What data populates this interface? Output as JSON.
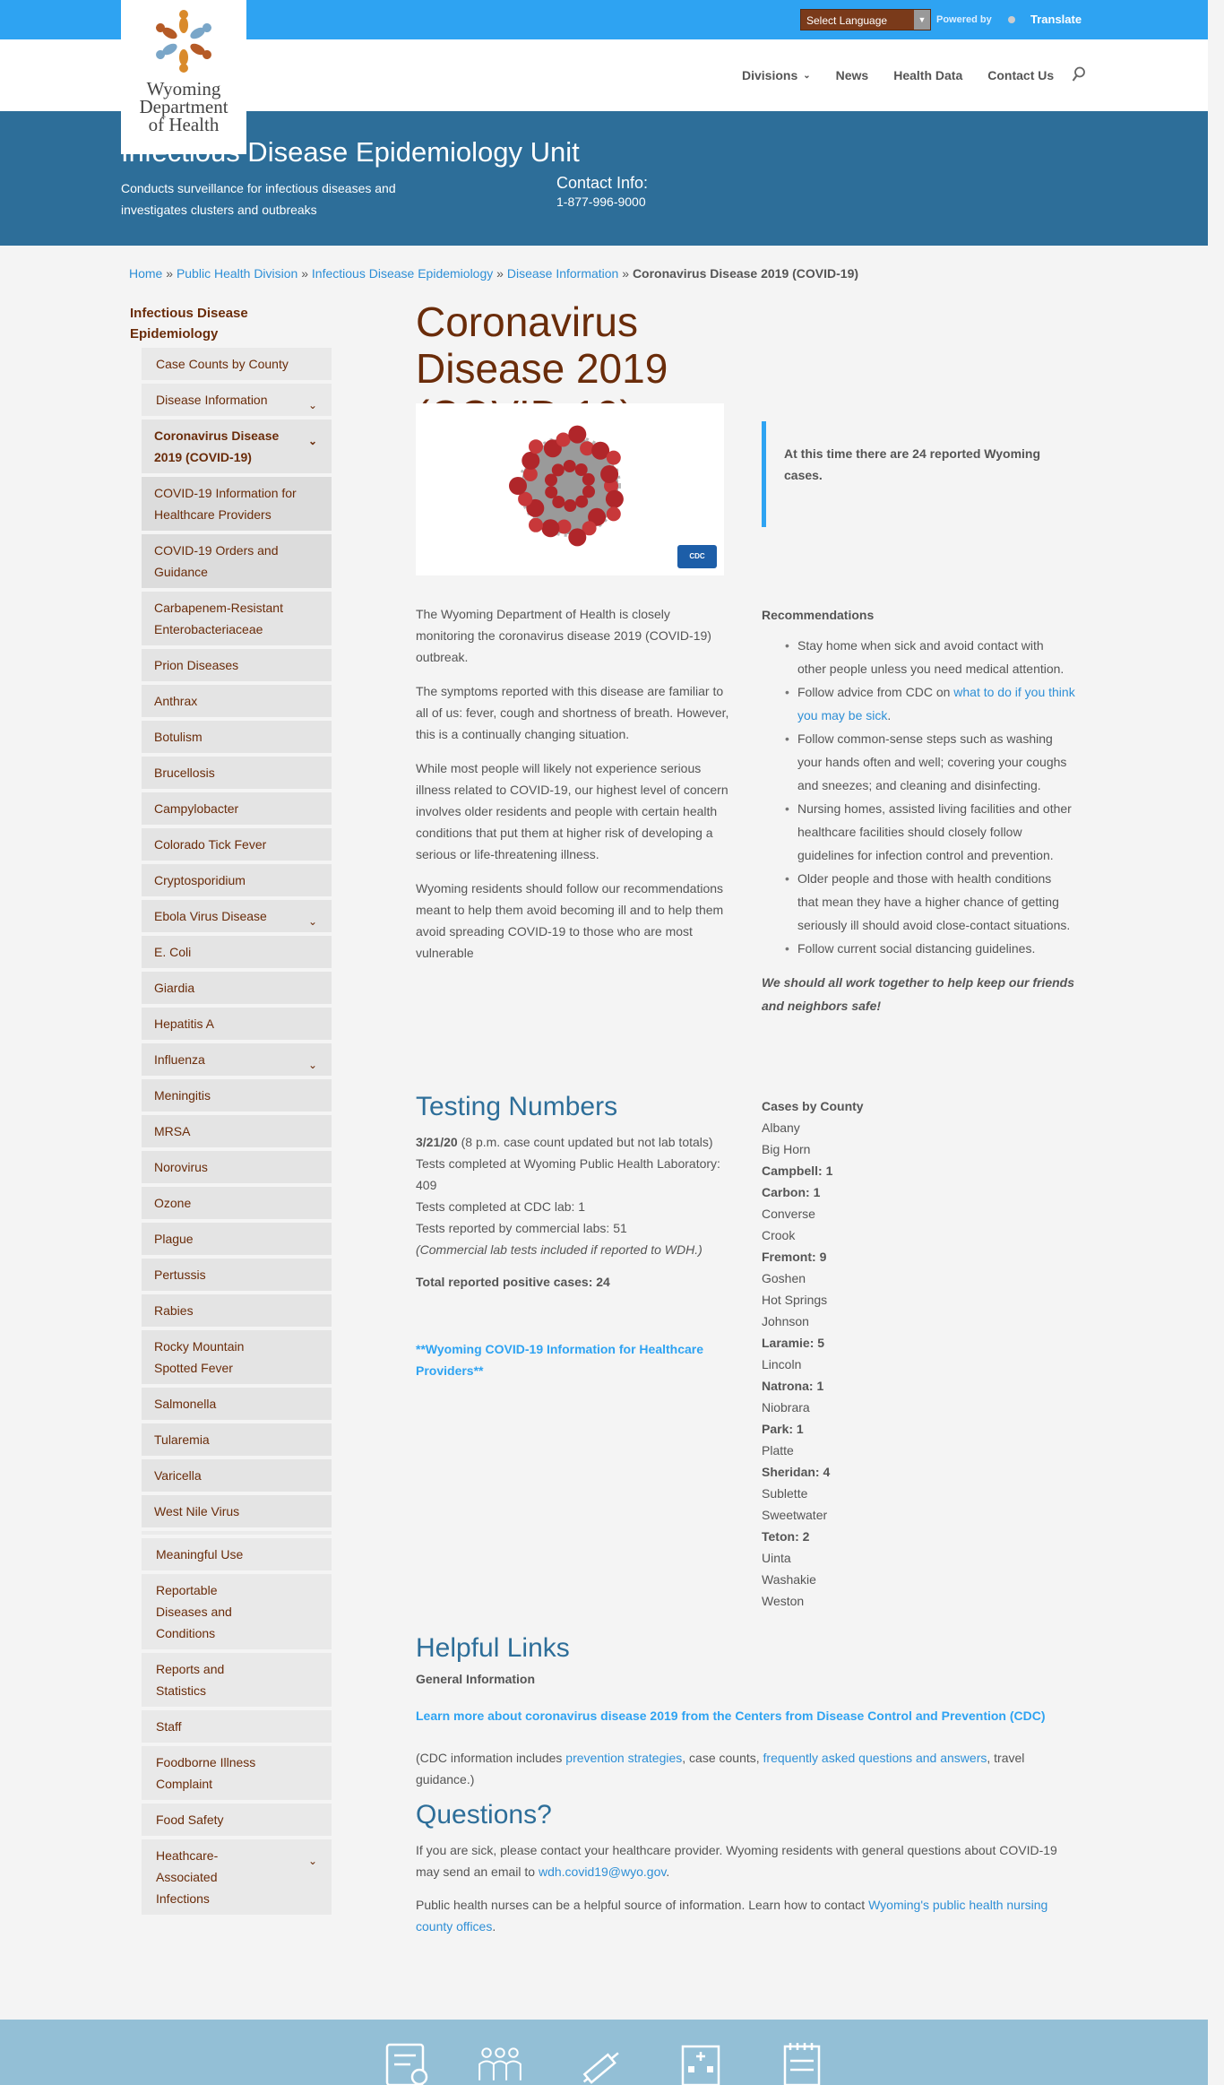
{
  "topbar": {
    "language_select": "Select Language",
    "powered_by": "Powered by",
    "translate": "Translate"
  },
  "logo": {
    "line1": "Wyoming",
    "line2": "Department",
    "line3": "of Health"
  },
  "nav": {
    "items": [
      "Divisions",
      "News",
      "Health Data",
      "Contact Us"
    ]
  },
  "banner": {
    "title": "Infectious Disease Epidemiology Unit",
    "description": "Conducts surveillance for infectious diseases and investigates clusters and outbreaks",
    "contact_label": "Contact Info:",
    "contact_phone": "1-877-996-9000"
  },
  "breadcrumb": {
    "items": [
      "Home",
      "Public Health Division",
      "Infectious Disease Epidemiology",
      "Disease Information"
    ],
    "separator": "»",
    "current": "Coronavirus Disease 2019 (COVID-19)"
  },
  "sidebar": {
    "heading": "Infectious Disease Epidemiology",
    "case_counts": "Case Counts by County",
    "disease_information": "Disease Information",
    "covid": "Coronavirus Disease 2019 (COVID-19)",
    "covid_sub": [
      "COVID-19 Information for Healthcare Providers",
      "COVID-19 Orders and Guidance"
    ],
    "diseases": [
      "Carbapenem-Resistant Enterobacteriaceae",
      "Prion Diseases",
      "Anthrax",
      "Botulism",
      "Brucellosis",
      "Campylobacter",
      "Colorado Tick Fever",
      "Cryptosporidium",
      "Ebola Virus Disease",
      "E. Coli",
      "Giardia",
      "Hepatitis A",
      "Influenza",
      "Meningitis",
      "MRSA",
      "Norovirus",
      "Ozone",
      "Plague",
      "Pertussis",
      "Rabies",
      "Rocky Mountain Spotted Fever",
      "Salmonella",
      "Tularemia",
      "Varicella",
      "West Nile Virus"
    ],
    "bottom": [
      "Meaningful Use",
      "Reportable Diseases and Conditions",
      "Reports and Statistics",
      "Staff",
      "Foodborne Illness Complaint",
      "Food Safety",
      "Heathcare-Associated Infections"
    ]
  },
  "main": {
    "title": "Coronavirus Disease 2019 (COVID-19)",
    "image_badge": "CDC",
    "callout": "At this time there are 24 reported Wyoming cases.",
    "intro": [
      "The Wyoming Department of Health is closely monitoring the coronavirus disease 2019 (COVID-19) outbreak.",
      "The symptoms reported with this disease are familiar to all of us: fever, cough and shortness of breath. However, this is a continually changing situation.",
      "While most people will likely not experience serious illness related to COVID-19, our highest level of concern involves older residents and people with certain health conditions that put them at higher risk of developing a serious or life-threatening illness.",
      "Wyoming residents should follow our recommendations meant to help them avoid becoming ill and to help them avoid spreading COVID-19 to those who are most vulnerable"
    ],
    "recommendations": {
      "title": "Recommendations",
      "item1": "Stay home when sick and avoid contact with other people unless you need medical attention.",
      "item2_prefix": "Follow advice from CDC on ",
      "item2_link": "what to do if you think you may be sick",
      "item2_suffix": ".",
      "item3": "Follow common-sense steps such as washing your hands often and well; covering your coughs and sneezes; and cleaning and disinfecting.",
      "item4": "Nursing homes, assisted living facilities and other healthcare facilities should closely follow guidelines for infection control and prevention.",
      "item5": "Older people and those with health conditions that mean they have a higher chance of getting seriously ill should avoid close-contact situations.",
      "item6": "Follow current social distancing guidelines.",
      "closing": "We should all work together to help keep our friends and neighbors safe!"
    },
    "testing": {
      "title": "Testing Numbers",
      "date": "3/21/20",
      "date_note": " (8 p.m. case count updated but not lab totals)",
      "public_lab": "Tests completed at Wyoming Public Health Laboratory: 409",
      "cdc_lab": "Tests completed at CDC lab: 1",
      "commercial": "Tests reported by commercial labs: 51",
      "commercial_note": "(Commercial lab tests included if reported to WDH.)",
      "total": "Total reported positive cases: 24",
      "healthcare_link": "**Wyoming COVID-19 Information for Healthcare Providers**"
    },
    "cases_by_county": {
      "title": "Cases by County",
      "counties": [
        {
          "name": "Albany",
          "count": ""
        },
        {
          "name": "Big Horn",
          "count": ""
        },
        {
          "name": "Campbell",
          "count": "1"
        },
        {
          "name": "Carbon",
          "count": "1"
        },
        {
          "name": "Converse",
          "count": ""
        },
        {
          "name": "Crook",
          "count": ""
        },
        {
          "name": "Fremont",
          "count": "9"
        },
        {
          "name": "Goshen",
          "count": ""
        },
        {
          "name": "Hot Springs",
          "count": ""
        },
        {
          "name": "Johnson",
          "count": ""
        },
        {
          "name": "Laramie",
          "count": "5"
        },
        {
          "name": "Lincoln",
          "count": ""
        },
        {
          "name": "Natrona",
          "count": "1"
        },
        {
          "name": "Niobrara",
          "count": ""
        },
        {
          "name": "Park",
          "count": "1"
        },
        {
          "name": "Platte",
          "count": ""
        },
        {
          "name": "Sheridan",
          "count": "4"
        },
        {
          "name": "Sublette",
          "count": ""
        },
        {
          "name": "Sweetwater",
          "count": ""
        },
        {
          "name": "Teton",
          "count": "2"
        },
        {
          "name": "Uinta",
          "count": ""
        },
        {
          "name": "Washakie",
          "count": ""
        },
        {
          "name": "Weston",
          "count": ""
        }
      ]
    },
    "helpful_links": {
      "title": "Helpful Links",
      "general": "General Information",
      "cdc_link": "Learn more about coronavirus disease 2019 from the Centers from Disease Control and Prevention (CDC)",
      "info_prefix": "(CDC information includes ",
      "prevention": "prevention strategies",
      "info_mid": ", case counts, ",
      "faq": "frequently asked questions and answers",
      "info_suffix": ", travel guidance.)"
    },
    "questions": {
      "title": "Questions?",
      "p1_prefix": "If you are sick, please contact your healthcare provider. Wyoming residents with general questions about COVID-19 may send an email to ",
      "email": "wdh.covid19@wyo.gov",
      "p1_suffix": ".",
      "p2_prefix": "Public health nurses can be a helpful source of information. Learn how to contact ",
      "nursing_link": "Wyoming's public health nursing county offices",
      "p2_suffix": "."
    }
  },
  "colors": {
    "topbar": "#2ea3f2",
    "banner": "#2d6e99",
    "brown": "#6a2c0a",
    "footer": "#93bfd6"
  }
}
